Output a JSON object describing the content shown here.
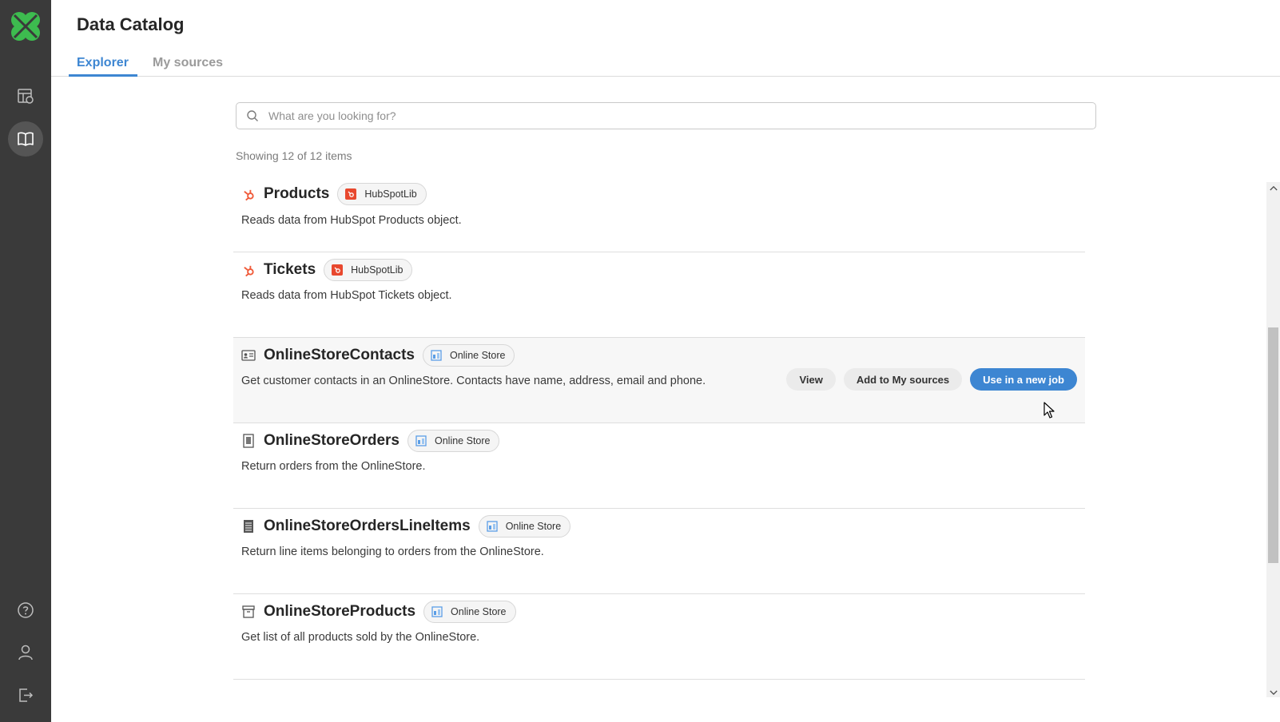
{
  "app": {
    "title": "Data Catalog",
    "brand_color": "#3d86d2",
    "sidebar_color": "#3a3a3a"
  },
  "sidebar": {
    "top_items": [
      {
        "icon": "table-settings-icon",
        "active": false
      },
      {
        "icon": "book-icon",
        "active": true
      }
    ],
    "bottom_items": [
      {
        "icon": "help-icon"
      },
      {
        "icon": "user-icon"
      },
      {
        "icon": "logout-icon"
      }
    ]
  },
  "tabs": [
    {
      "label": "Explorer",
      "active": true
    },
    {
      "label": "My sources",
      "active": false
    }
  ],
  "search": {
    "placeholder": "What are you looking for?",
    "value": ""
  },
  "results": {
    "count_text": "Showing 12 of 12 items"
  },
  "items": [
    {
      "name": "Products",
      "icon": "hubspot-icon",
      "chip": "HubSpotLib",
      "chip_icon": "hubspot-badge-icon",
      "description": "Reads data from HubSpot Products object."
    },
    {
      "name": "Tickets",
      "icon": "hubspot-icon",
      "chip": "HubSpotLib",
      "chip_icon": "hubspot-badge-icon",
      "description": "Reads data from HubSpot Tickets object."
    },
    {
      "name": "OnlineStoreContacts",
      "icon": "contact-card-icon",
      "chip": "Online Store",
      "chip_icon": "store-icon",
      "description": "Get customer contacts in an OnlineStore. Contacts have name, address, email and phone."
    },
    {
      "name": "OnlineStoreOrders",
      "icon": "receipt-icon",
      "chip": "Online Store",
      "chip_icon": "store-icon",
      "description": "Return orders from the OnlineStore."
    },
    {
      "name": "OnlineStoreOrdersLineItems",
      "icon": "line-items-icon",
      "chip": "Online Store",
      "chip_icon": "store-icon",
      "description": "Return line items belonging to orders from the OnlineStore."
    },
    {
      "name": "OnlineStoreProducts",
      "icon": "box-icon",
      "chip": "Online Store",
      "chip_icon": "store-icon",
      "description": "Get list of all products sold by the OnlineStore."
    }
  ],
  "hover_actions": {
    "view": "View",
    "add": "Add to My sources",
    "use": "Use in a new job"
  }
}
